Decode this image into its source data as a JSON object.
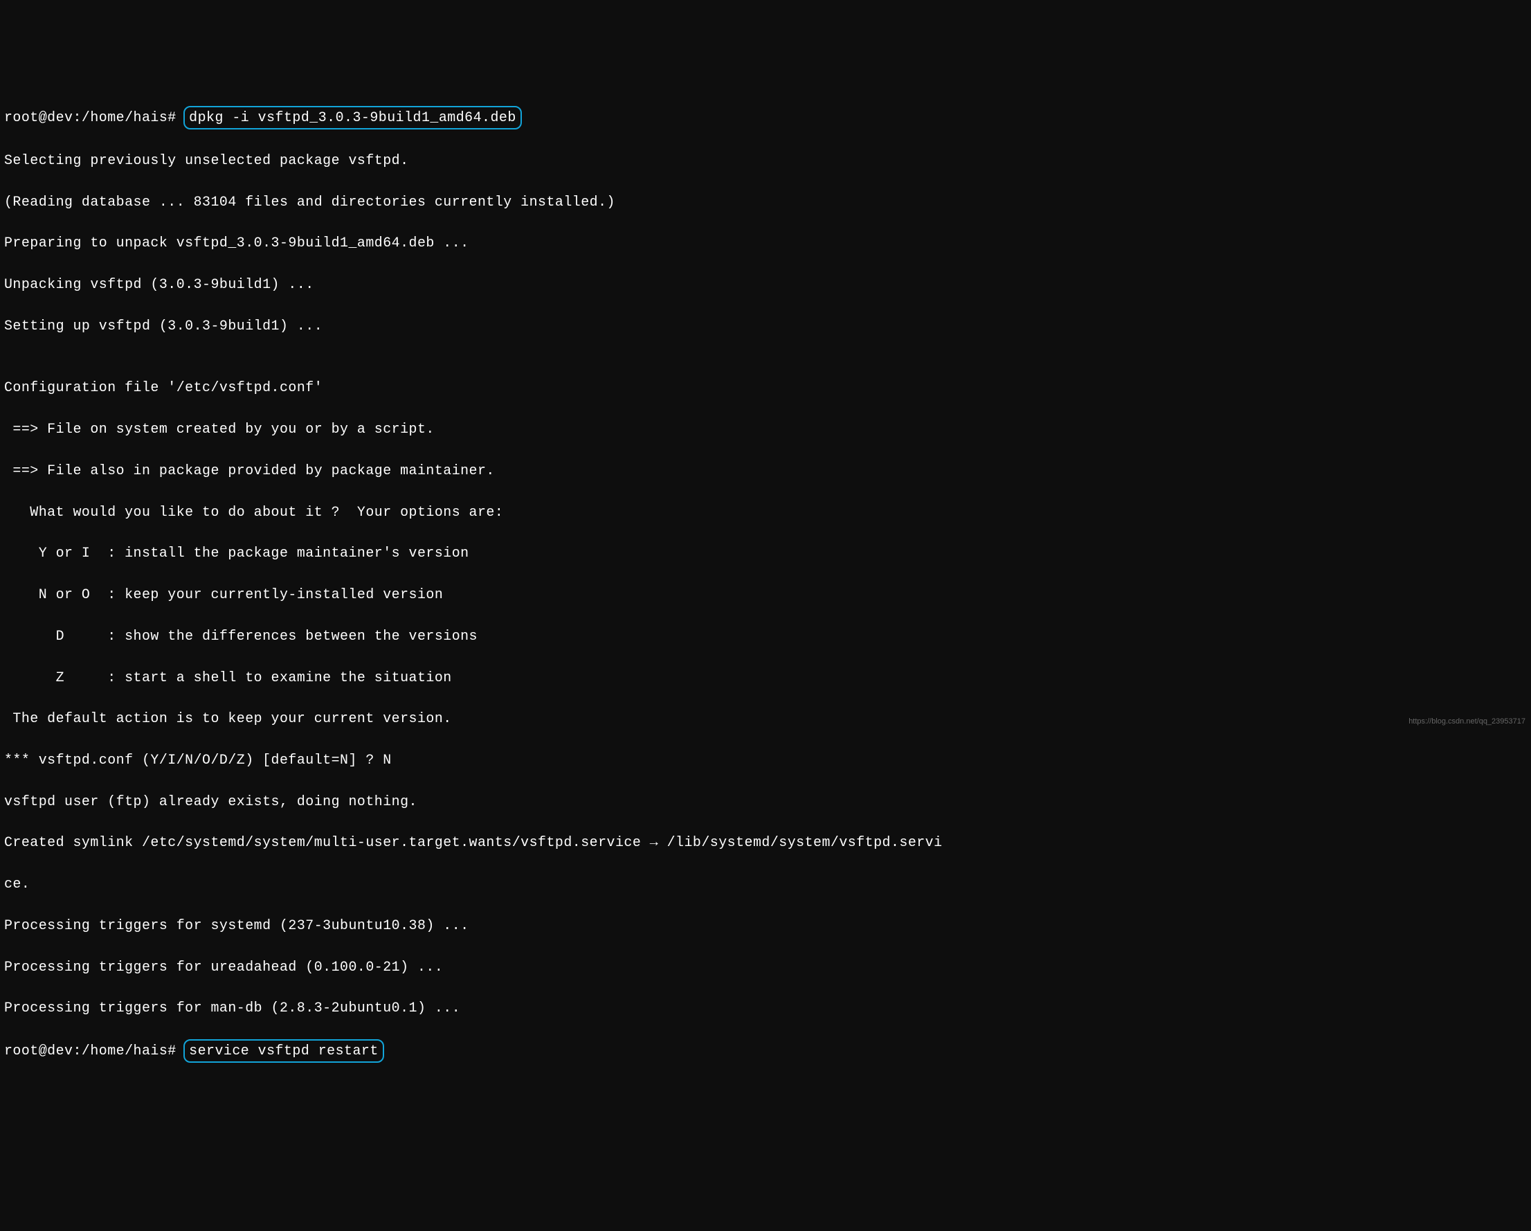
{
  "terminal": {
    "prompt1_prefix": "root@dev:/home/hais# ",
    "cmd1": "dpkg -i vsftpd_3.0.3-9build1_amd64.deb",
    "lines": [
      "Selecting previously unselected package vsftpd.",
      "(Reading database ... 83104 files and directories currently installed.)",
      "Preparing to unpack vsftpd_3.0.3-9build1_amd64.deb ...",
      "Unpacking vsftpd (3.0.3-9build1) ...",
      "Setting up vsftpd (3.0.3-9build1) ...",
      "",
      "Configuration file '/etc/vsftpd.conf'",
      " ==> File on system created by you or by a script.",
      " ==> File also in package provided by package maintainer.",
      "   What would you like to do about it ?  Your options are:",
      "    Y or I  : install the package maintainer's version",
      "    N or O  : keep your currently-installed version",
      "      D     : show the differences between the versions",
      "      Z     : start a shell to examine the situation",
      " The default action is to keep your current version.",
      "*** vsftpd.conf (Y/I/N/O/D/Z) [default=N] ? N",
      "vsftpd user (ftp) already exists, doing nothing.",
      "Created symlink /etc/systemd/system/multi-user.target.wants/vsftpd.service → /lib/systemd/system/vsftpd.servi",
      "ce.",
      "Processing triggers for systemd (237-3ubuntu10.38) ...",
      "Processing triggers for ureadahead (0.100.0-21) ...",
      "Processing triggers for man-db (2.8.3-2ubuntu0.1) ..."
    ],
    "prompt2_prefix": "root@dev:/home/hais# ",
    "cmd2": "service vsftpd restart"
  },
  "watermark": "https://blog.csdn.net/qq_23953717"
}
